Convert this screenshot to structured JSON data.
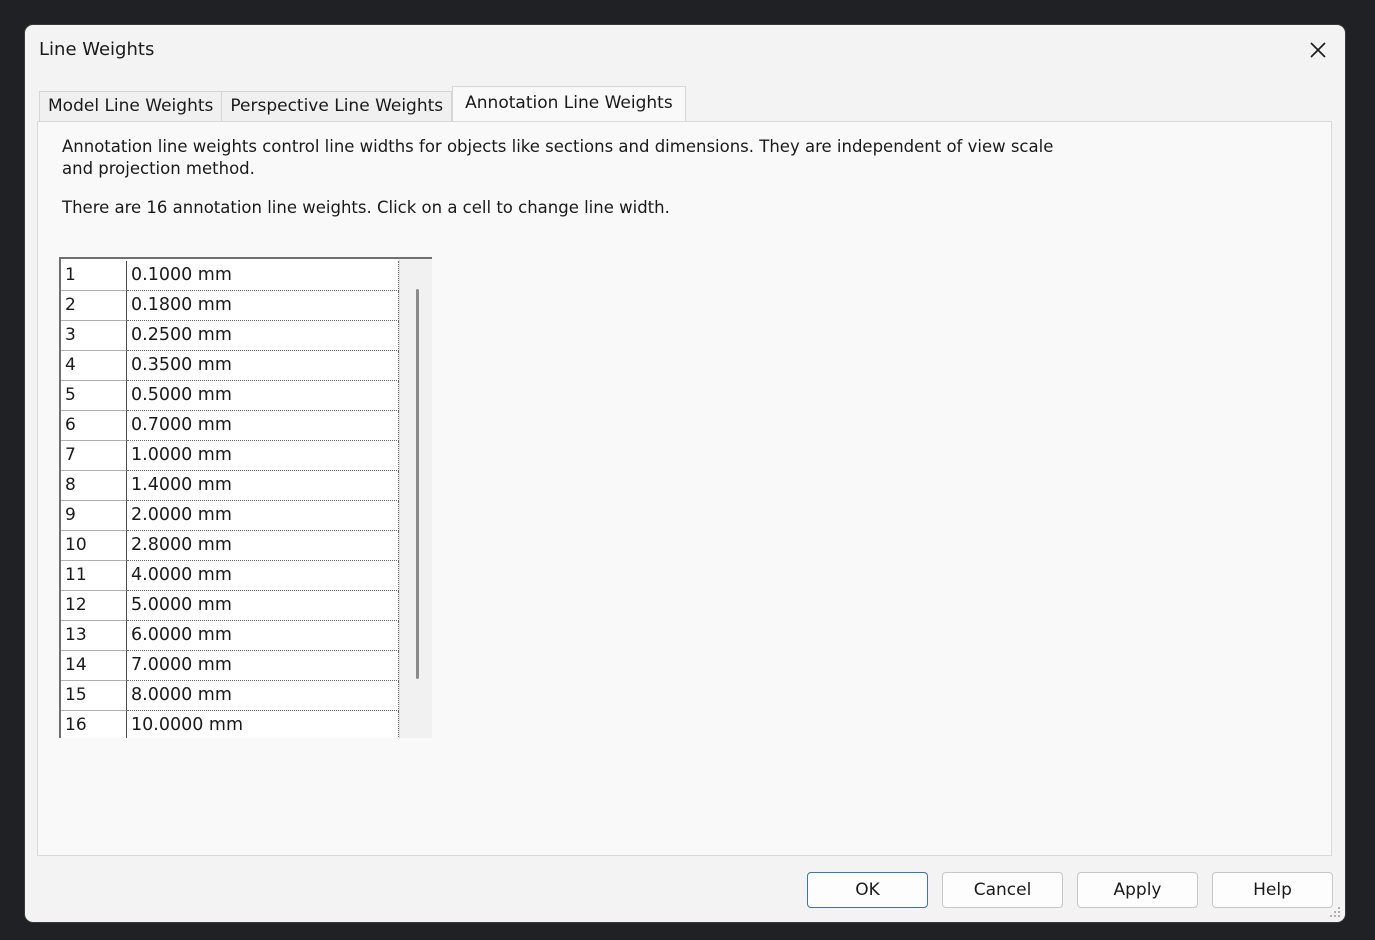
{
  "window": {
    "title": "Line Weights"
  },
  "tabs": [
    {
      "label": "Model Line Weights",
      "active": false
    },
    {
      "label": "Perspective Line Weights",
      "active": false
    },
    {
      "label": "Annotation Line Weights",
      "active": true
    }
  ],
  "panel": {
    "description": "Annotation line weights control line widths for objects like sections and dimensions. They are independent of view scale and projection method.",
    "count_text": "There are 16 annotation line weights. Click on a cell to change line width."
  },
  "grid": {
    "rows": [
      {
        "index": "1",
        "value": "0.1000 mm"
      },
      {
        "index": "2",
        "value": "0.1800 mm"
      },
      {
        "index": "3",
        "value": "0.2500 mm"
      },
      {
        "index": "4",
        "value": "0.3500 mm"
      },
      {
        "index": "5",
        "value": "0.5000 mm"
      },
      {
        "index": "6",
        "value": "0.7000 mm"
      },
      {
        "index": "7",
        "value": "1.0000 mm"
      },
      {
        "index": "8",
        "value": "1.4000 mm"
      },
      {
        "index": "9",
        "value": "2.0000 mm"
      },
      {
        "index": "10",
        "value": "2.8000 mm"
      },
      {
        "index": "11",
        "value": "4.0000 mm"
      },
      {
        "index": "12",
        "value": "5.0000 mm"
      },
      {
        "index": "13",
        "value": "6.0000 mm"
      },
      {
        "index": "14",
        "value": "7.0000 mm"
      },
      {
        "index": "15",
        "value": "8.0000 mm"
      },
      {
        "index": "16",
        "value": "10.0000 mm"
      }
    ]
  },
  "buttons": {
    "ok": "OK",
    "cancel": "Cancel",
    "apply": "Apply",
    "help": "Help"
  },
  "icons": {
    "close": "close-icon",
    "resize": "resize-grip-icon"
  },
  "colors": {
    "primary_border": "#3a73b8",
    "dialog_bg": "#f3f3f3"
  }
}
